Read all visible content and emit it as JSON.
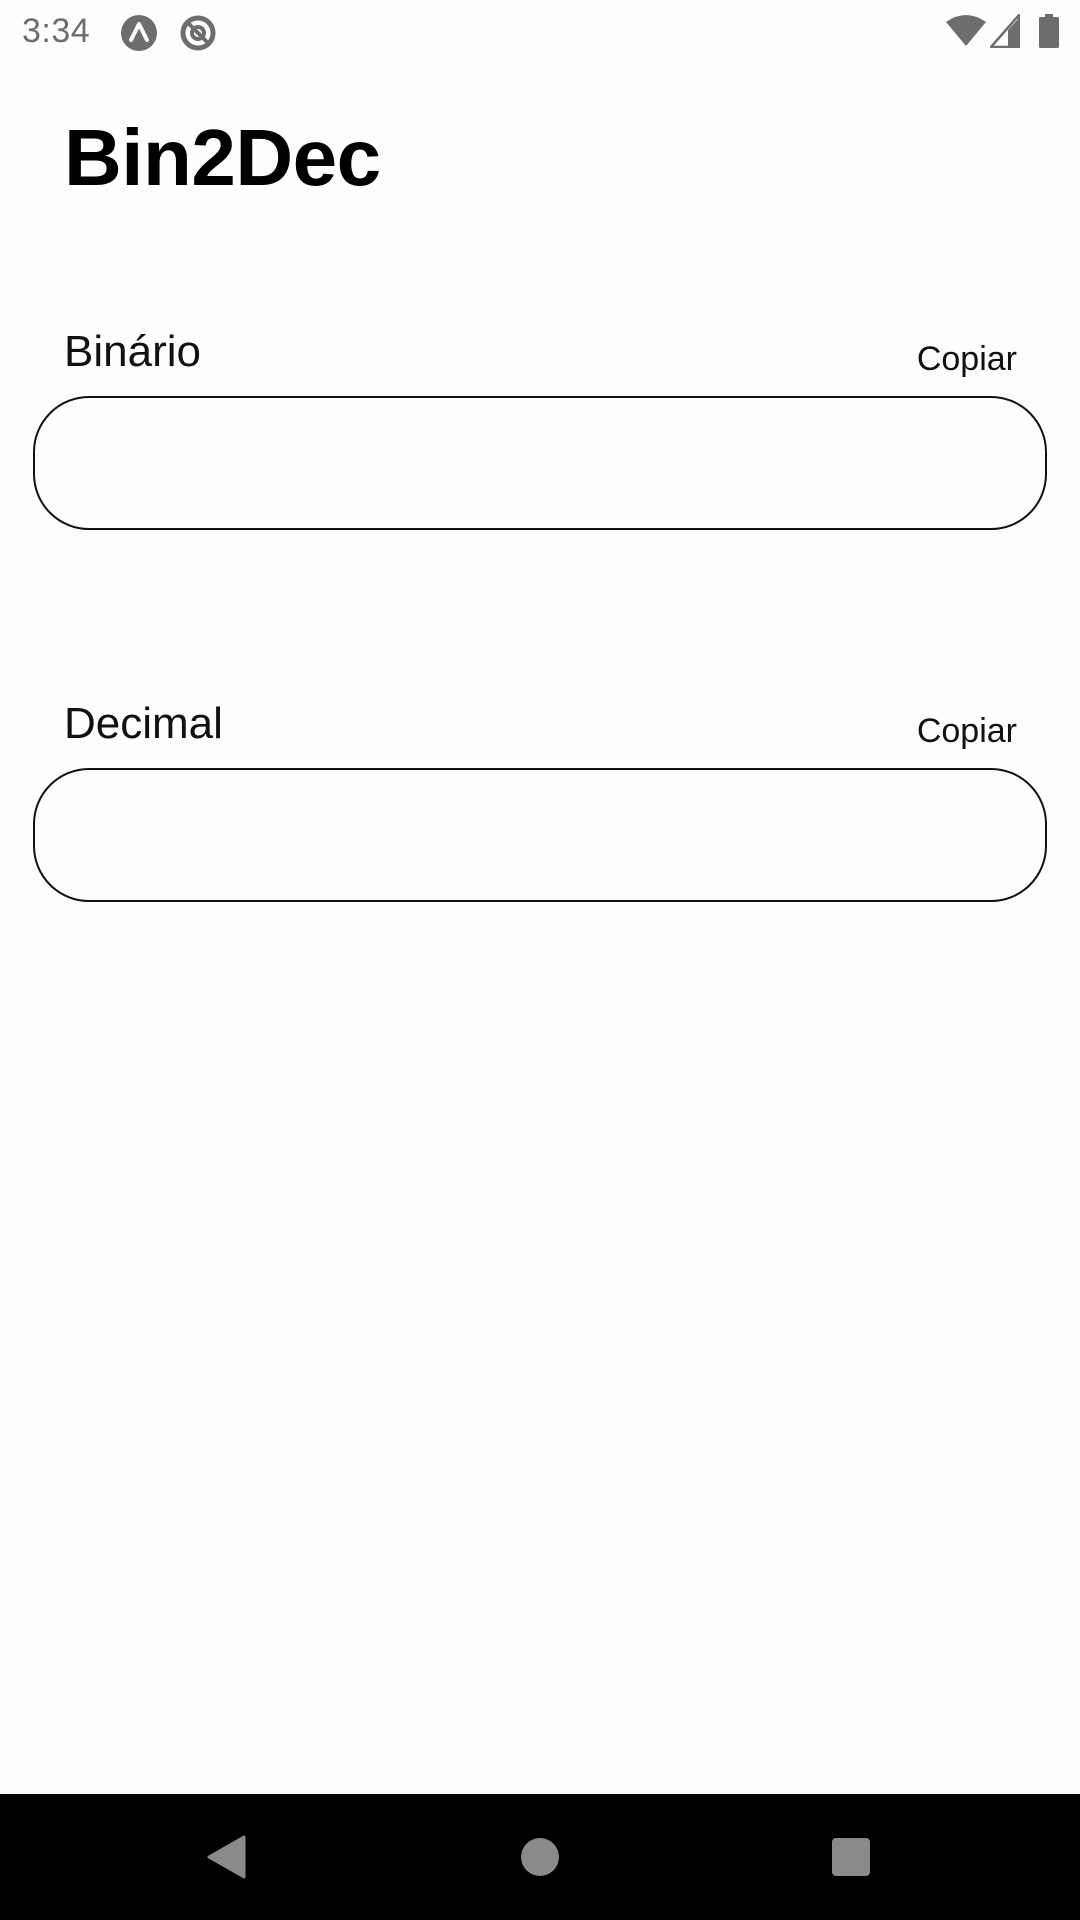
{
  "status_bar": {
    "time": "3:34",
    "left_icons": [
      "app-notification-icon",
      "sync-disabled-icon"
    ],
    "right_icons": [
      "wifi-icon",
      "cellular-signal-icon",
      "battery-icon"
    ]
  },
  "app": {
    "title": "Bin2Dec"
  },
  "binary": {
    "label": "Binário",
    "copy_label": "Copiar",
    "value": ""
  },
  "decimal": {
    "label": "Decimal",
    "copy_label": "Copiar",
    "value": ""
  },
  "nav_bar": {
    "buttons": [
      "back-icon",
      "home-icon",
      "recents-icon"
    ]
  },
  "colors": {
    "background": "#fdfdfd",
    "text": "#000000",
    "status_text": "#6d6d6d",
    "nav_bar": "#000000",
    "nav_icons": "#8a8a8a"
  }
}
